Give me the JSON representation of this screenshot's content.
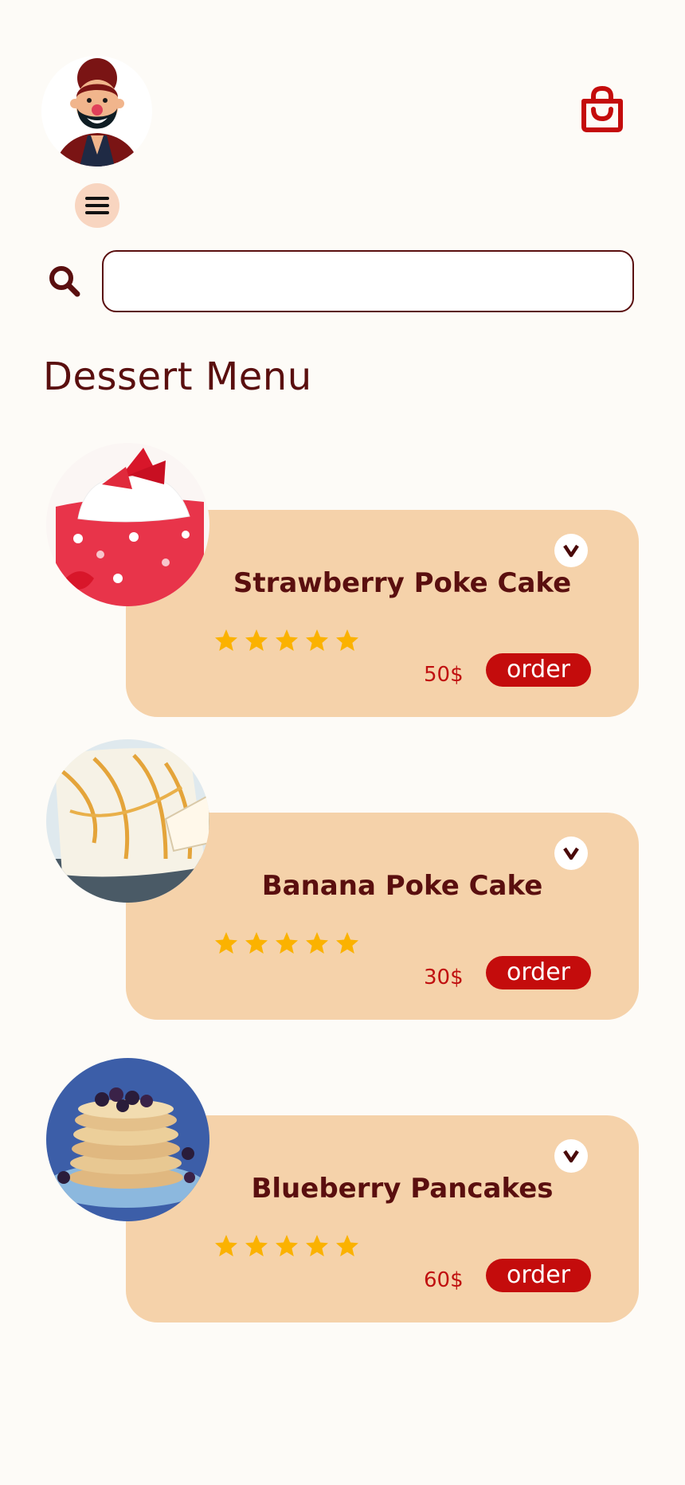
{
  "header": {
    "avatar_icon": "bearded-man-avatar",
    "cart_icon": "shopping-bag-icon",
    "menu_icon": "hamburger-menu-icon"
  },
  "search": {
    "icon": "magnifier-icon",
    "value": "",
    "placeholder": ""
  },
  "page": {
    "title": "Dessert Menu"
  },
  "colors": {
    "background": "#fdfbf7",
    "card": "#f5d2aa",
    "title": "#5a0f0f",
    "accent": "#c40c0c",
    "star": "#fbb200",
    "menu_button": "#f8d5c0"
  },
  "rating_scale": 5,
  "menu": {
    "items": [
      {
        "name": "Strawberry Poke Cake",
        "price": "50$",
        "order_label": "order",
        "rating": 5,
        "image_icon": "strawberry-poke-cake-photo"
      },
      {
        "name": "Banana Poke Cake",
        "price": "30$",
        "order_label": "order",
        "rating": 5,
        "image_icon": "banana-poke-cake-photo"
      },
      {
        "name": "Blueberry Pancakes",
        "price": "60$",
        "order_label": "order",
        "rating": 5,
        "image_icon": "blueberry-pancakes-photo"
      }
    ]
  }
}
